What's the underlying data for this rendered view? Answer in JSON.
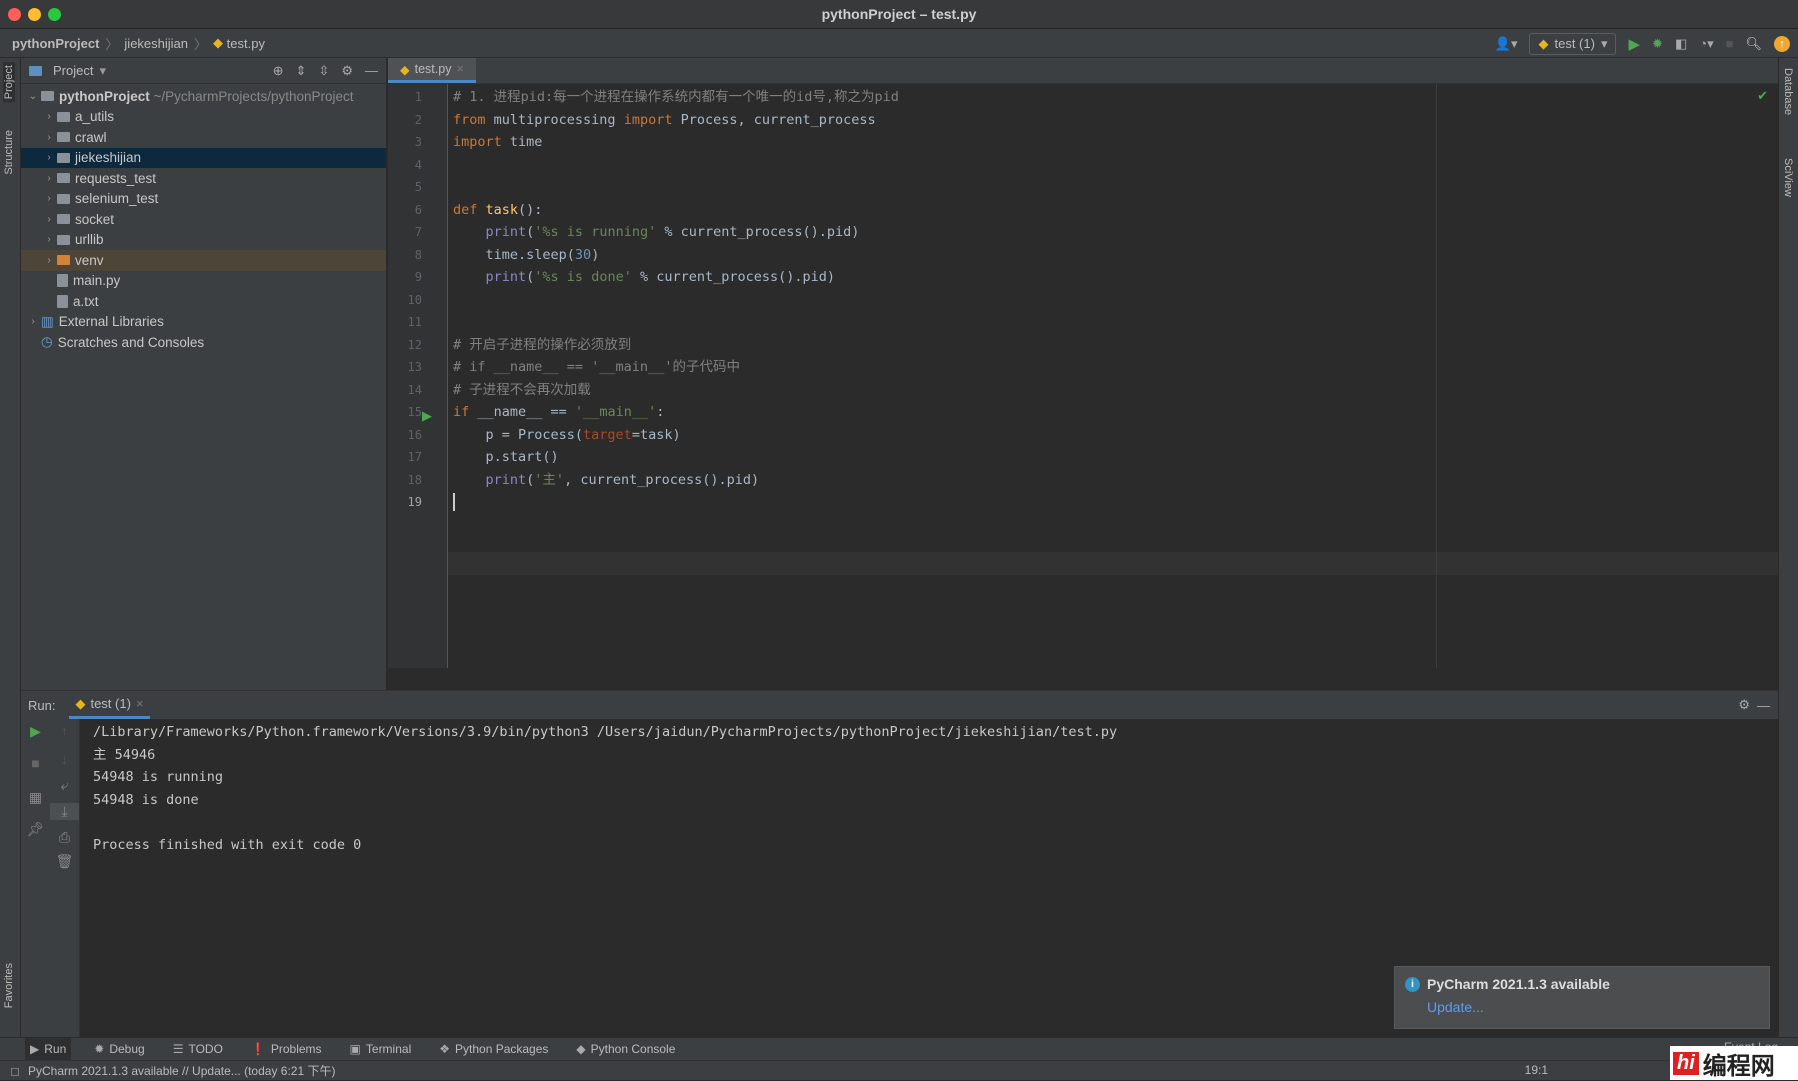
{
  "window": {
    "title": "pythonProject – test.py"
  },
  "breadcrumb": [
    "pythonProject",
    "jiekeshijian",
    "test.py"
  ],
  "toolbar": {
    "run_config": "test (1)",
    "icons": [
      "user-icon",
      "run-icon",
      "debug-icon",
      "coverage-icon",
      "profile-icon",
      "stop-icon",
      "search-icon",
      "update-icon"
    ]
  },
  "left_stripe": {
    "project": "Project",
    "structure": "Structure",
    "favorites": "Favorites"
  },
  "right_stripe": {
    "database": "Database",
    "sciview": "SciView"
  },
  "project": {
    "header": "Project",
    "root": {
      "name": "pythonProject",
      "path": "~/PycharmProjects/pythonProject"
    },
    "items": [
      {
        "name": "a_utils",
        "type": "folder"
      },
      {
        "name": "crawl",
        "type": "folder"
      },
      {
        "name": "jiekeshijian",
        "type": "folder",
        "selected": true
      },
      {
        "name": "requests_test",
        "type": "folder"
      },
      {
        "name": "selenium_test",
        "type": "folder"
      },
      {
        "name": "socket",
        "type": "folder"
      },
      {
        "name": "urllib",
        "type": "folder"
      },
      {
        "name": "venv",
        "type": "folder"
      },
      {
        "name": "main.py",
        "type": "file"
      },
      {
        "name": "a.txt",
        "type": "file"
      }
    ],
    "external": "External Libraries",
    "scratches": "Scratches and Consoles"
  },
  "editor": {
    "tab": "test.py",
    "current_line": 19,
    "lines": [
      "# 1. 进程pid:每一个进程在操作系统内都有一个唯一的id号,称之为pid",
      "from multiprocessing import Process, current_process",
      "import time",
      "",
      "",
      "def task():",
      "    print('%s is running' % current_process().pid)",
      "    time.sleep(30)",
      "    print('%s is done' % current_process().pid)",
      "",
      "",
      "# 开启子进程的操作必须放到",
      "# if __name__ == '__main__'的子代码中",
      "# 子进程不会再次加载",
      "if __name__ == '__main__':",
      "    p = Process(target=task)",
      "    p.start()",
      "    print('主', current_process().pid)",
      ""
    ]
  },
  "run": {
    "label": "Run:",
    "tab": "test (1)",
    "output": [
      "/Library/Frameworks/Python.framework/Versions/3.9/bin/python3 /Users/jaidun/PycharmProjects/pythonProject/jiekeshijian/test.py",
      "主 54946",
      "54948 is running",
      "54948 is done",
      "",
      "Process finished with exit code 0"
    ]
  },
  "bottom_tabs": [
    "Run",
    "Debug",
    "TODO",
    "Problems",
    "Terminal",
    "Python Packages",
    "Python Console"
  ],
  "status": {
    "text": "PyCharm 2021.1.3 available // Update... (today 6:21 下午)",
    "event_log": "Event Log",
    "position": "19:1"
  },
  "notification": {
    "title": "PyCharm 2021.1.3 available",
    "link": "Update..."
  },
  "watermark": "编程网"
}
